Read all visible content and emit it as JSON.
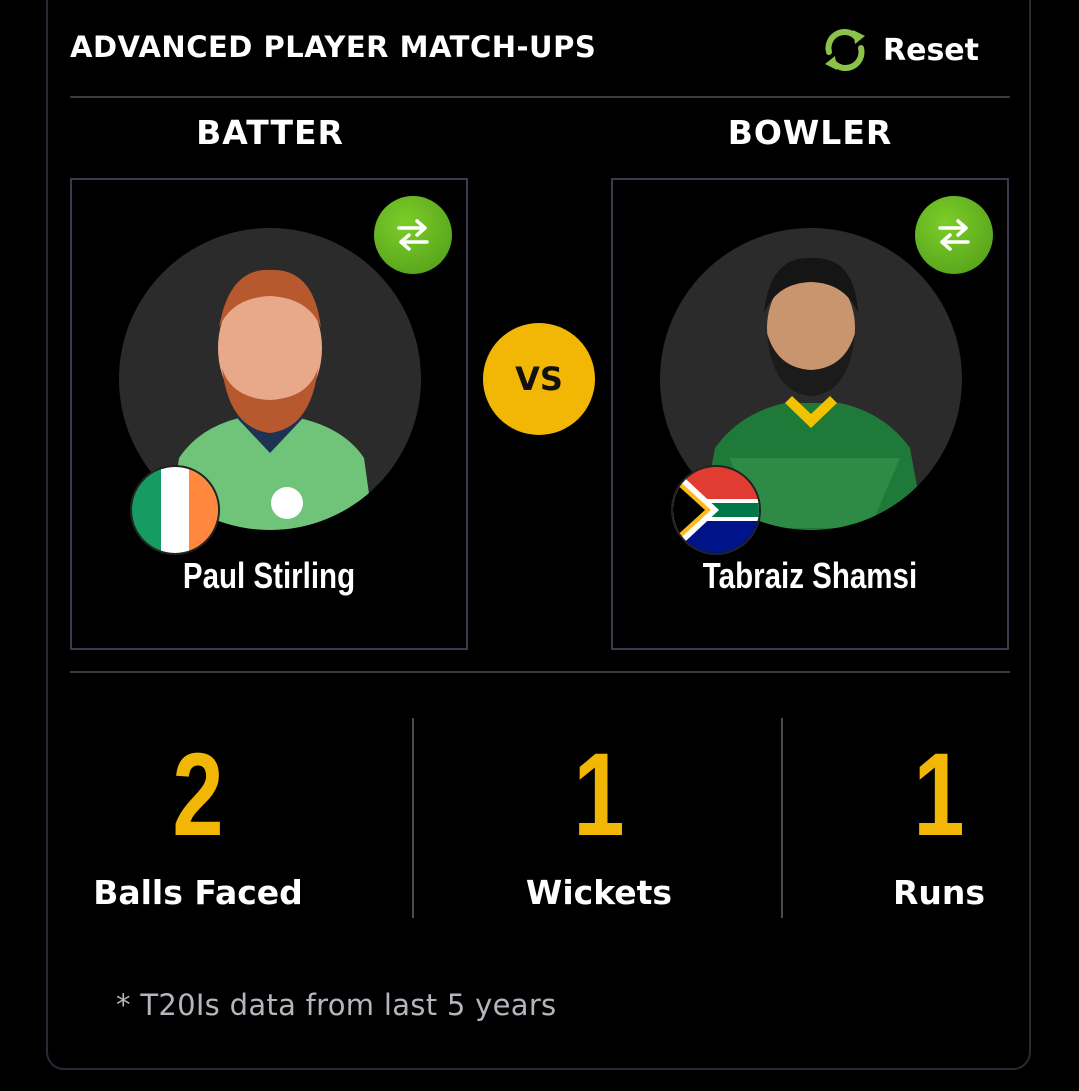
{
  "header": {
    "title": "ADVANCED PLAYER MATCH-UPS",
    "reset_label": "Reset"
  },
  "batter": {
    "column_label": "BATTER",
    "name": "Paul Stirling",
    "flag_icon": "ireland-flag-icon"
  },
  "bowler": {
    "column_label": "BOWLER",
    "name": "Tabraiz Shamsi",
    "flag_icon": "south-africa-flag-icon"
  },
  "vs_label": "VS",
  "stats": [
    {
      "value": "2",
      "label": "Balls Faced"
    },
    {
      "value": "1",
      "label": "Wickets"
    },
    {
      "value": "1",
      "label": "Runs"
    }
  ],
  "footnote": "* T20Is data from last 5 years",
  "colors": {
    "accent_yellow": "#f2b705",
    "swap_green": "#5fae1f",
    "background": "#000000"
  }
}
